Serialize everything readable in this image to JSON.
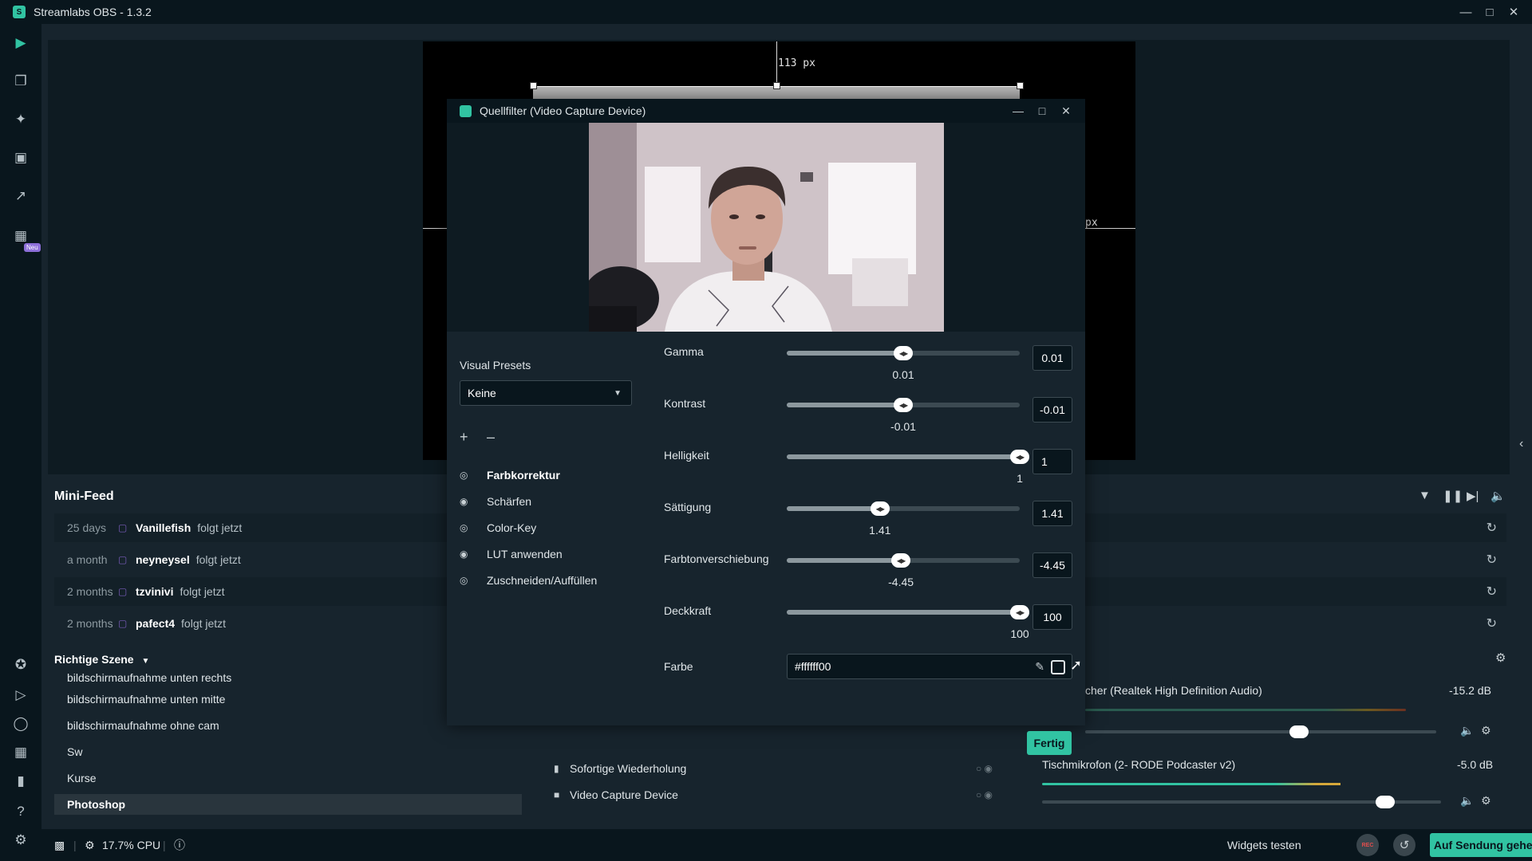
{
  "app": {
    "title": "Streamlabs OBS - 1.3.2",
    "logo_glyph": "S"
  },
  "sidebar": {
    "badge_new": "Neu"
  },
  "editor": {
    "guide_top": "113 px",
    "guide_right": "px"
  },
  "minifeed": {
    "title": "Mini-Feed",
    "rows": [
      {
        "time": "25 days",
        "name": "Vanillefish",
        "action": "folgt jetzt"
      },
      {
        "time": "a month",
        "name": "neyneysel",
        "action": "folgt jetzt"
      },
      {
        "time": "2 months",
        "name": "tzvinivi",
        "action": "folgt jetzt"
      },
      {
        "time": "2 months",
        "name": "pafect4",
        "action": "folgt jetzt"
      }
    ]
  },
  "scenes": {
    "title": "Richtige Szene",
    "items": [
      "bildschirmaufnahme unten rechts",
      "bildschirmaufnahme unten mitte",
      "bildschirmaufnahme ohne cam",
      "Sw",
      "Kurse",
      "Photoshop"
    ]
  },
  "sources": {
    "items": [
      "Sofortige Wiederholung",
      "Video Capture Device"
    ]
  },
  "mixer": {
    "channels": [
      {
        "name": "cher (Realtek High Definition Audio)",
        "db": "-15.2 dB",
        "level": 0.61
      },
      {
        "name": "Tischmikrofon (2- RODE Podcaster v2)",
        "db": "-5.0 dB",
        "level": 0.86
      }
    ]
  },
  "footer": {
    "cpu": "17.7% CPU",
    "widgets": "Widgets testen",
    "rec": "REC",
    "go_live": "Auf Sendung gehen"
  },
  "dialog": {
    "title": "Quellfilter (Video Capture Device)",
    "presets_label": "Visual Presets",
    "preset_value": "Keine",
    "filters": [
      {
        "name": "Farbkorrektur",
        "active": true
      },
      {
        "name": "Schärfen",
        "active": false
      },
      {
        "name": "Color-Key",
        "active": false
      },
      {
        "name": "LUT anwenden",
        "active": false
      },
      {
        "name": "Zuschneiden/Auffüllen",
        "active": false
      }
    ],
    "params": [
      {
        "label": "Gamma",
        "value": "0.01",
        "fraction": 0.5
      },
      {
        "label": "Kontrast",
        "value": "-0.01",
        "fraction": 0.5
      },
      {
        "label": "Helligkeit",
        "value": "1",
        "fraction": 1.0
      },
      {
        "label": "Sättigung",
        "value": "1.41",
        "fraction": 0.4
      },
      {
        "label": "Farbtonverschiebung",
        "value": "-4.45",
        "fraction": 0.49
      },
      {
        "label": "Deckkraft",
        "value": "100",
        "fraction": 1.0
      }
    ],
    "color_label": "Farbe",
    "color_value": "#ffffff00",
    "done": "Fertig"
  },
  "colors": {
    "accent": "#31c3a2",
    "background": "#17242d",
    "dark": "#09161d"
  }
}
